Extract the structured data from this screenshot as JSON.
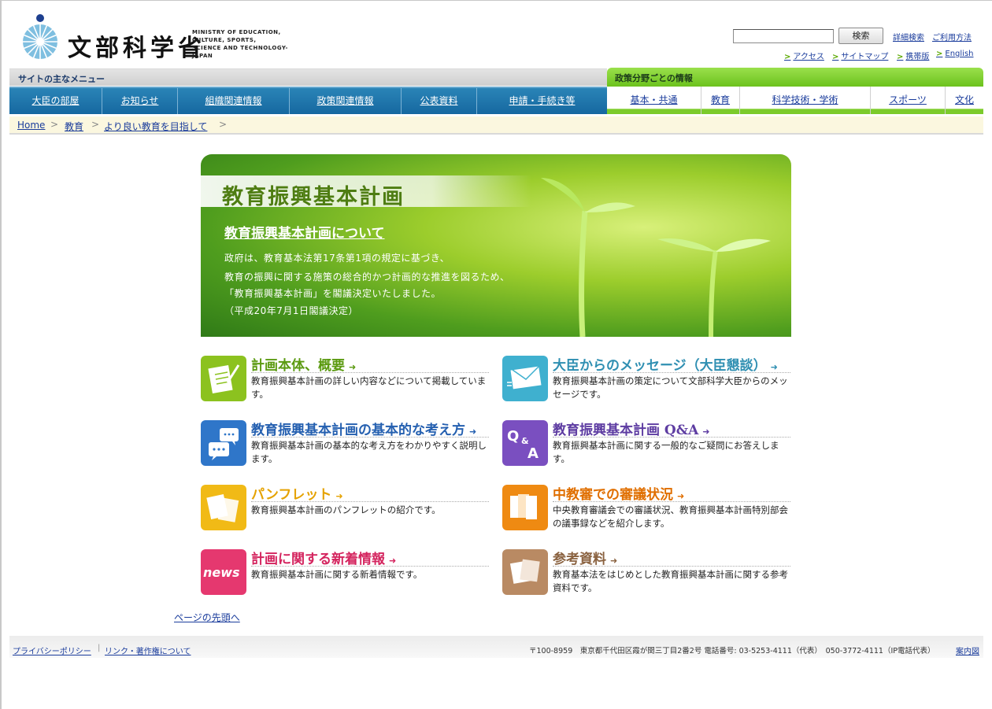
{
  "header": {
    "logo_text": "文部科学省",
    "logo_en": [
      "MINISTRY OF EDUCATION,",
      "CULTURE, SPORTS,",
      "SCIENCE AND TECHNOLOGY-JAPAN"
    ],
    "search_button": "検索",
    "search_value": "",
    "links": [
      "詳細検索",
      "ご利用方法"
    ],
    "sub_links": [
      "アクセス",
      "サイトマップ",
      "携帯版",
      "English"
    ]
  },
  "nav": {
    "left_label": "サイトの主なメニュー",
    "right_label": "政策分野ごとの情報",
    "left_items": [
      "大臣の部屋",
      "お知らせ",
      "組織関連情報",
      "政策関連情報",
      "公表資料",
      "申請・手続き等"
    ],
    "right_items": [
      "基本・共通",
      "教育",
      "科学技術・学術",
      "スポーツ",
      "文化"
    ]
  },
  "breadcrumb": [
    "Home",
    "教育",
    "より良い教育を目指して"
  ],
  "hero": {
    "title": "教育振興基本計画",
    "subtitle": "教育振興基本計画について",
    "lines": [
      "政府は、教育基本法第17条第1項の規定に基づき、",
      "教育の振興に関する施策の総合的かつ計画的な推進を図るため、",
      "「教育振興基本計画」を閣議決定いたしました。",
      "（平成20年7月1日閣議決定）"
    ]
  },
  "cards": [
    {
      "title": "計画本体、概要",
      "desc": "教育振興基本計画の詳しい内容などについて掲載しています。",
      "color": "#8cc21f",
      "icon": "document-pen-icon"
    },
    {
      "title": "大臣からのメッセージ（大臣懇談）",
      "desc": "教育振興基本計画の策定について文部科学大臣からのメッセージです。",
      "color": "#3fb0cf",
      "icon": "envelope-icon"
    },
    {
      "title": "教育振興基本計画の基本的な考え方",
      "desc": "教育振興基本計画の基本的な考え方をわかりやすく説明します。",
      "color": "#2f76c9",
      "icon": "speech-bubbles-icon"
    },
    {
      "title": "教育振興基本計画 Q&A",
      "desc": "教育振興基本計画に関する一般的なご疑問にお答えします。",
      "color": "#7a4fc0",
      "icon": "qa-icon"
    },
    {
      "title": "パンフレット",
      "desc": "教育振興基本計画のパンフレットの紹介です。",
      "color": "#f1ba16",
      "icon": "pamphlet-icon"
    },
    {
      "title": "中教審での審議状況",
      "desc": "中央教育審議会での審議状況、教育振興基本計画特別部会の議事録などを紹介します。",
      "color": "#ef8a12",
      "icon": "files-icon"
    },
    {
      "title": "計画に関する新着情報",
      "desc": "教育振興基本計画に関する新着情報です。",
      "color": "#e5386f",
      "icon": "news-icon"
    },
    {
      "title": "参考資料",
      "desc": "教育基本法をはじめとした教育振興基本計画に関する参考資料です。",
      "color": "#b98a63",
      "icon": "papers-icon"
    }
  ],
  "page_top": "ページの先頭へ",
  "footer": {
    "links": [
      "プライバシーポリシー",
      "リンク・著作権について"
    ],
    "address": "〒100-8959　東京都千代田区霞が関三丁目2番2号 電話番号: 03-5253-4111（代表）　050-3772-4111（IP電話代表）",
    "map": "案内図"
  }
}
